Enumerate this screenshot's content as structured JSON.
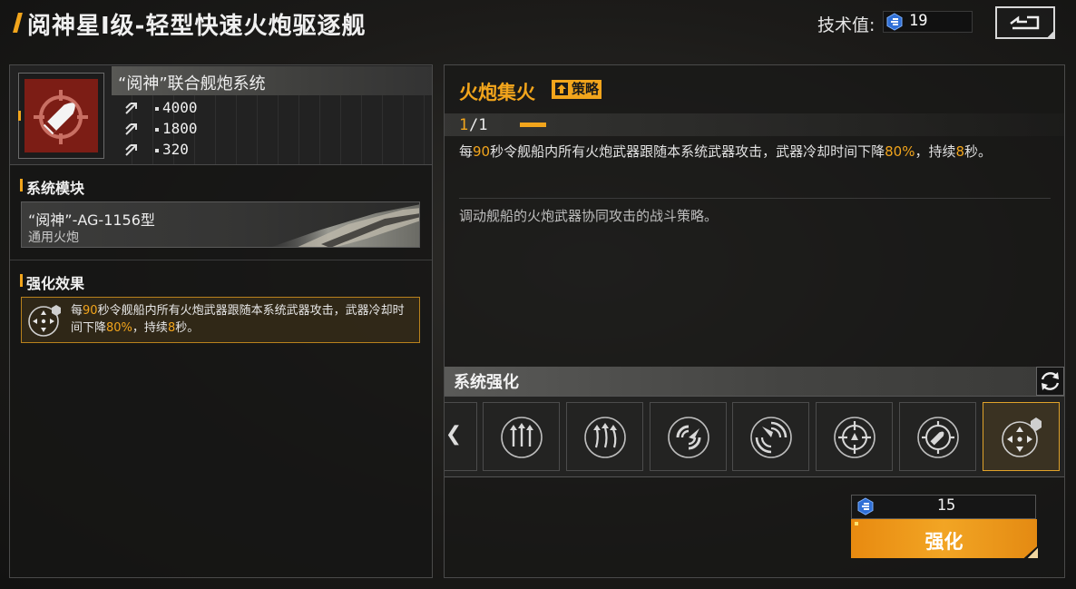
{
  "header": {
    "title": "阅神星I级-轻型快速火炮驱逐舰",
    "tech_label": "技术值:",
    "tech_value": "19",
    "back_icon": "back-return-icon"
  },
  "left_panel": {
    "system_name": "“阅神”联合舰炮系统",
    "system_icon": "shell-target-icon",
    "stats": [
      {
        "icon": "stat-arrow-icon",
        "value": "4000"
      },
      {
        "icon": "stat-arrow-icon",
        "value": "1800"
      },
      {
        "icon": "stat-arrow-icon",
        "value": "320"
      }
    ],
    "module_section_title": "系统模块",
    "module": {
      "name": "“阅神”-AG-1156型",
      "type": "通用火炮"
    },
    "effect_section_title": "强化效果",
    "effect": {
      "icon": "fire-focus-icon",
      "t1": "每",
      "h1": "90",
      "t2": "秒令舰船内所有火炮武器跟随本系统武器攻击，武器冷却时间下降",
      "h2": "80%",
      "t3": "，持续",
      "h3": "8",
      "t4": "秒。"
    }
  },
  "right_panel": {
    "strategy_title": "火炮集火",
    "badge_label": "策略",
    "level_current": "1",
    "level_max": "/1",
    "desc": {
      "t1": "每",
      "h1": "90",
      "t2": "秒令舰船内所有火炮武器跟随本系统武器攻击，武器冷却时间下降",
      "h2": "80%",
      "t3": "，持续",
      "h3": "8",
      "t4": "秒。"
    },
    "flavor": "调动舰船的火炮武器协同攻击的战斗策略。",
    "system_upgrade_title": "系统强化",
    "nav_left": "❮",
    "slots": [
      {
        "icon": "triple-arrow-up-icon"
      },
      {
        "icon": "triple-arrow-up-wave-icon"
      },
      {
        "icon": "radar-sweep-icon"
      },
      {
        "icon": "radar-sweep-alt-icon"
      },
      {
        "icon": "crosshair-target-icon"
      },
      {
        "icon": "crosshair-shell-icon"
      },
      {
        "icon": "fire-focus-icon"
      }
    ],
    "cost": "15",
    "upgrade_label": "强化"
  },
  "colors": {
    "accent": "#f2a51c",
    "icon_bg": "#7c1d15",
    "tech_icon": "#3d8af2"
  }
}
